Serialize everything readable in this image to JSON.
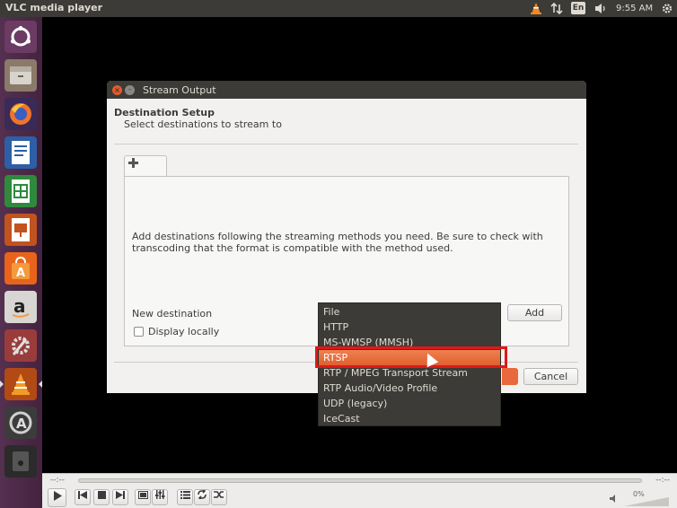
{
  "topbar": {
    "app_title": "VLC media player",
    "lang": "En",
    "clock": "9:55 AM"
  },
  "dialog": {
    "title": "Stream Output",
    "heading": "Destination Setup",
    "subheading": "Select destinations to stream to",
    "tab_icon": "plus-icon",
    "info": "Add destinations following the streaming methods you need. Be sure to check with transcoding that the format is compatible with the method used.",
    "new_destination_label": "New destination",
    "add_label": "Add",
    "display_locally_label": "Display locally",
    "cancel_label": "Cancel"
  },
  "dropdown": {
    "options": [
      "File",
      "HTTP",
      "MS-WMSP (MMSH)",
      "RTSP",
      "RTP / MPEG Transport Stream",
      "RTP Audio/Video Profile",
      "UDP (legacy)",
      "IceCast"
    ],
    "selected": "RTSP"
  },
  "controls": {
    "time_left": "--:--",
    "time_right": "--:--",
    "volume_pct": "0%"
  },
  "colors": {
    "accent": "#e9683c",
    "highlight_box": "#e01818",
    "panel": "#3c3b37",
    "launcher": "#4a2744"
  }
}
